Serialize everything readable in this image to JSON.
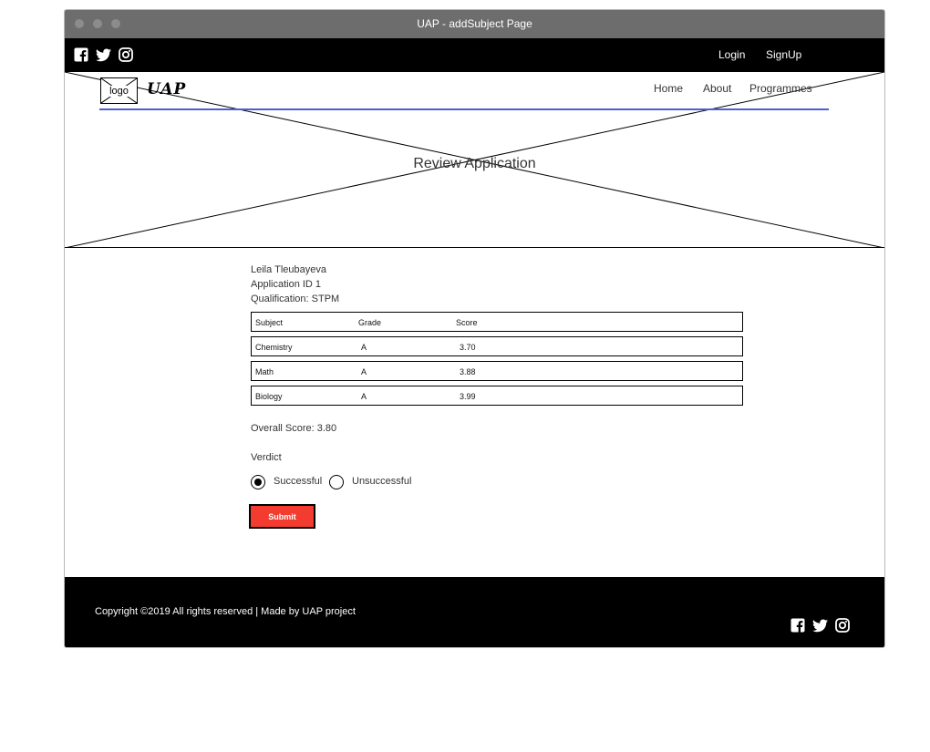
{
  "window": {
    "title": "UAP - addSubject Page"
  },
  "topbar": {
    "social_icons": [
      "facebook-icon",
      "twitter-icon",
      "instagram-icon"
    ],
    "login": "Login",
    "signup": "SignUp"
  },
  "header": {
    "logo_text": "logo",
    "brand": "UAP",
    "nav": {
      "home": "Home",
      "about": "About",
      "programmes": "Programmes"
    },
    "hero_title": "Review Application",
    "accent_color": "#4a5fd0"
  },
  "applicant": {
    "name": "Leila Tleubayeva",
    "application_id": "Application ID 1",
    "qualification": "Qualification: STPM"
  },
  "table": {
    "headers": [
      "Subject",
      "Grade",
      "Score"
    ],
    "rows": [
      [
        "Chemistry",
        "A",
        "3.70"
      ],
      [
        "Math",
        "A",
        "3.88"
      ],
      [
        "Biology",
        "A",
        "3.99"
      ]
    ]
  },
  "overall_score": "Overall Score: 3.80",
  "verdict": {
    "label": "Verdict",
    "options": [
      "Successful",
      "Unsuccessful"
    ],
    "selected": "Successful"
  },
  "submit": {
    "label": "Submit",
    "color": "#f43b2f"
  },
  "footer": {
    "copyright": "Copyright ©2019 All rights reserved | Made by UAP project",
    "social_icons": [
      "facebook-icon",
      "twitter-icon",
      "instagram-icon"
    ]
  }
}
